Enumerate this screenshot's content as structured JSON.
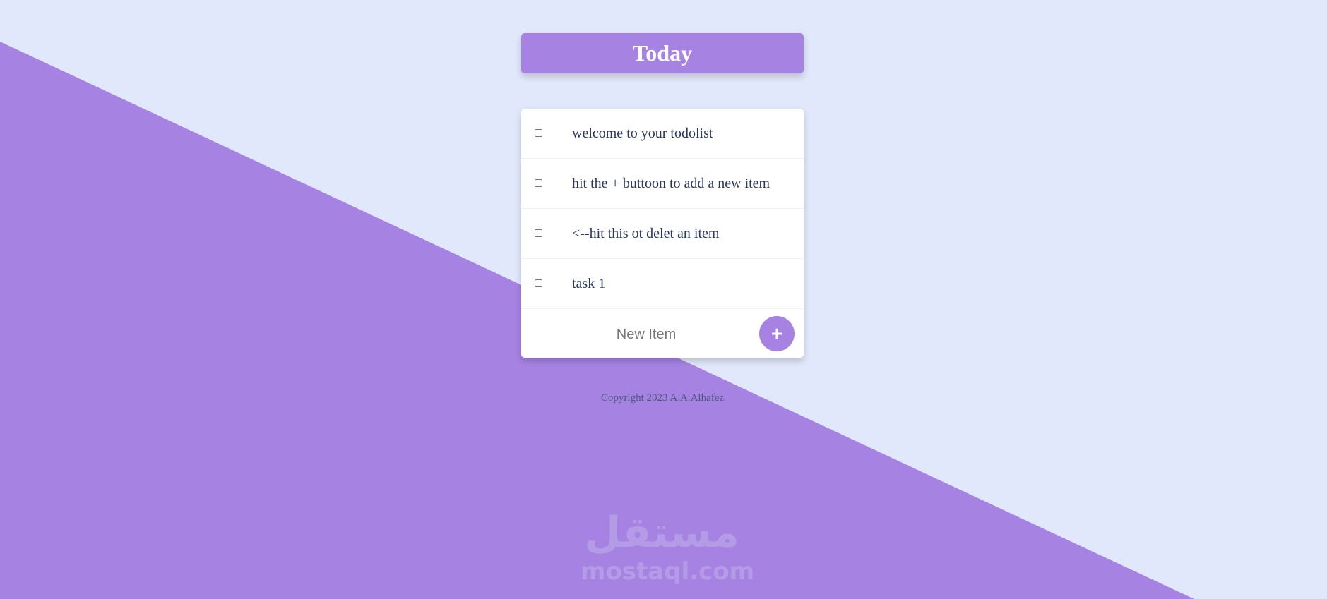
{
  "heading": {
    "title": "Today"
  },
  "items": [
    {
      "label": "welcome to your todolist",
      "checked": false
    },
    {
      "label": "hit the + buttoon to add a new item",
      "checked": false
    },
    {
      "label": "<--hit this ot delet an item",
      "checked": false
    },
    {
      "label": "task 1",
      "checked": false
    }
  ],
  "new_item": {
    "placeholder": "New Item",
    "value": "",
    "add_label": "+"
  },
  "footer": {
    "text": "Copyright 2023 A.A.Alhafez"
  },
  "watermark": {
    "arabic": "مستقل",
    "latin": "mostaql.com"
  },
  "colors": {
    "background": "#e2e8fb",
    "accent": "#a683e3",
    "text": "#283760"
  }
}
